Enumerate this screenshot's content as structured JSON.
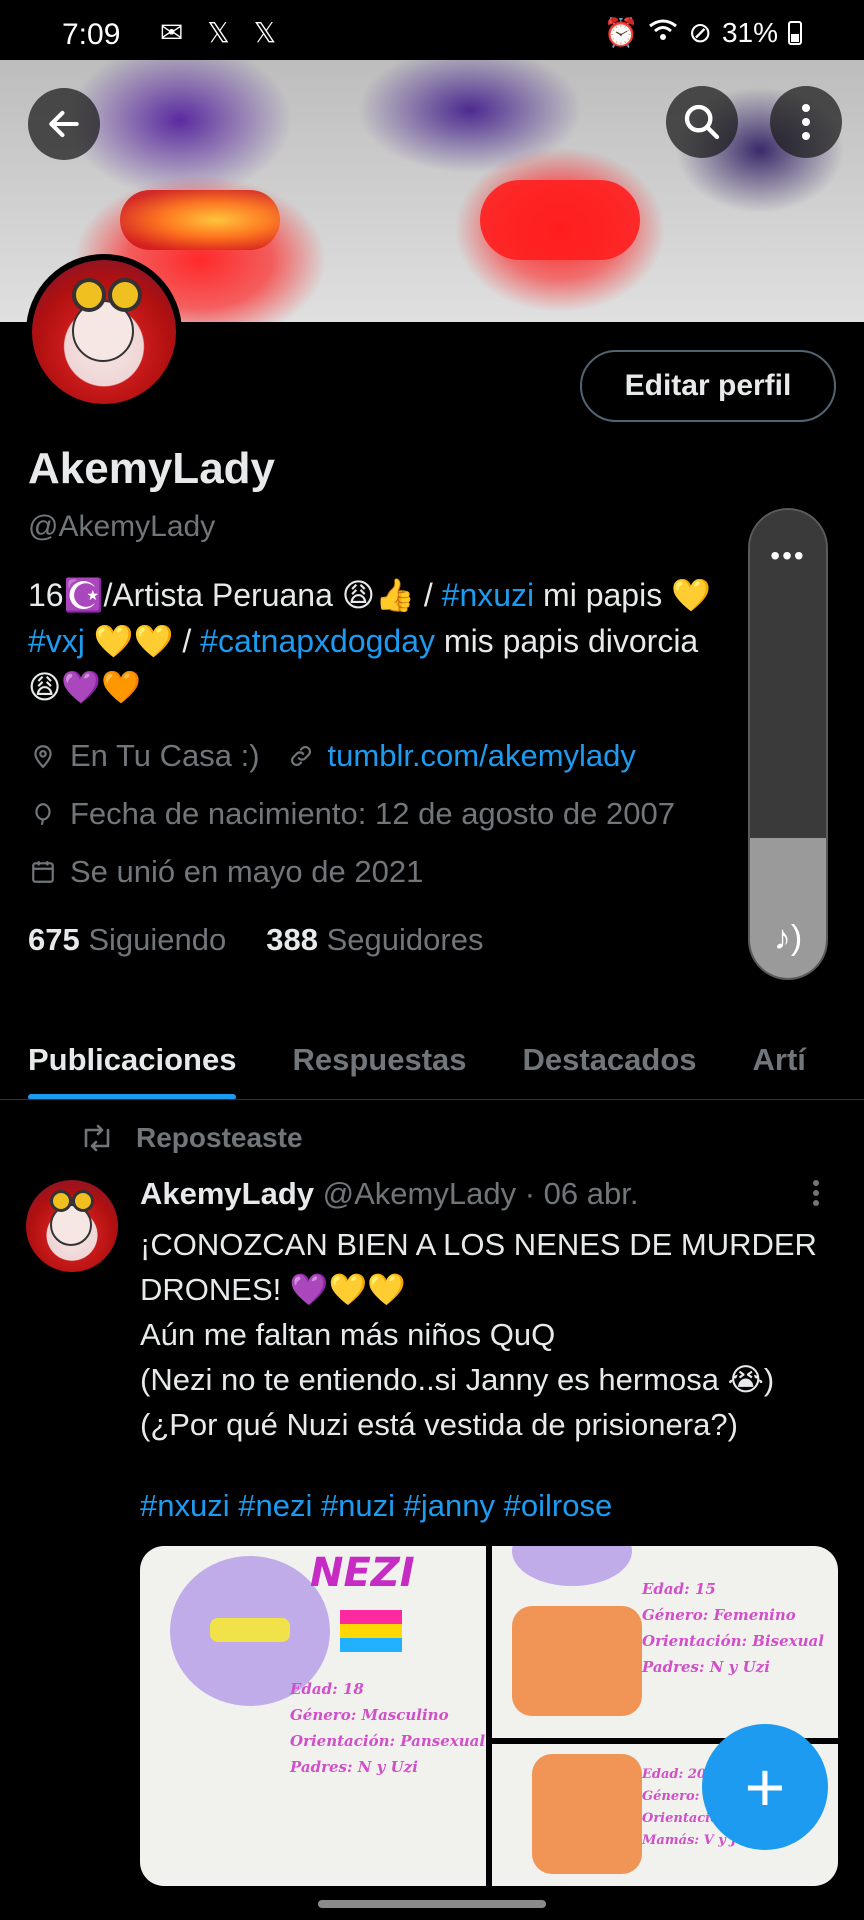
{
  "status_bar": {
    "time": "7:09",
    "left_icons": "✉ 𝕏 𝕏",
    "battery": "31%"
  },
  "profile": {
    "name": "AkemyLady",
    "handle": "@AkemyLady",
    "edit_label": "Editar perfil",
    "bio_line1_a": "16☪️/Artista Peruana 😩👍 / ",
    "bio_line1_tag": "#nxuzi",
    "bio_line1_b": " mi papis 💛",
    "bio_line2_tag1": "#vxj",
    "bio_line2_a": " 💛💛 / ",
    "bio_line2_tag2": "#catnapxdogday",
    "bio_line2_b": " mis papis divorcia",
    "bio_line3": "😩💜🧡",
    "location": "En Tu Casa :)",
    "website": "tumblr.com/akemylady",
    "birthday": "Fecha de nacimiento: 12 de agosto de 2007",
    "joined": "Se unió en mayo de 2021",
    "following_count": "675",
    "following_label": "Siguiendo",
    "followers_count": "388",
    "followers_label": "Seguidores"
  },
  "volume": {
    "level": 0.3
  },
  "tabs": [
    {
      "label": "Publicaciones",
      "active": true
    },
    {
      "label": "Respuestas"
    },
    {
      "label": "Destacados"
    },
    {
      "label": "Artí"
    }
  ],
  "post": {
    "repost_label": "Reposteaste",
    "author": "AkemyLady",
    "meta": "@AkemyLady · 06 abr.",
    "body": "¡CONOZCAN BIEN A LOS NENES DE MURDER DRONES! 💜💛💛\nAún me faltan más niños QuQ\n(Nezi no te entiendo..si Janny es hermosa 😭)\n(¿Por qué Nuzi está vestida de prisionera?)",
    "tags": "#nxuzi #nezi #nuzi #janny #oilrose",
    "media": {
      "img1_title": "NEZI",
      "img1_caption": "Edad: 18\nGénero: Masculino\nOrientación: Pansexual\nPadres: N y Uzi",
      "img2_caption": "Edad: 15\nGénero: Femenino\nOrientación: Bisexual\nPadres: N y Uzi",
      "img3_caption": "Edad: 20\nGénero: F\nOrientación: Bisexual\nMamás: V y J"
    }
  }
}
